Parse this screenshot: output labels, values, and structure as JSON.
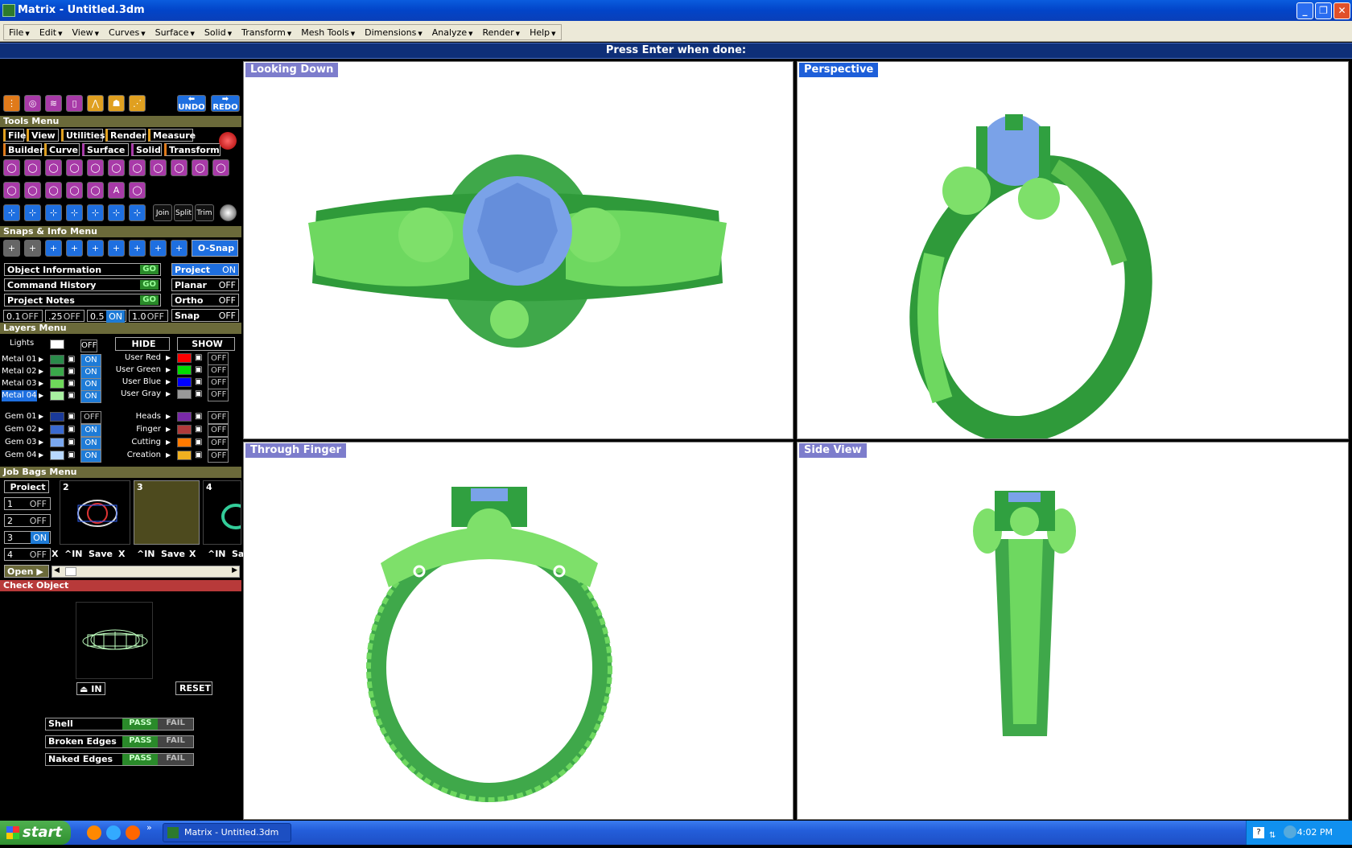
{
  "window": {
    "title": "Matrix -  Untitled.3dm"
  },
  "menubar": [
    "File",
    "Edit",
    "View",
    "Curves",
    "Surface",
    "Solid",
    "Transform",
    "Mesh Tools",
    "Dimensions",
    "Analyze",
    "Render",
    "Help"
  ],
  "prompt": "Press Enter when done:",
  "toolbar": {
    "undo": "UNDO",
    "redo": "REDO"
  },
  "tools_menu": {
    "header": "Tools Menu",
    "row1": [
      "File",
      "View",
      "Utilities",
      "Render",
      "Measure"
    ],
    "row2": [
      "Builder",
      "Curve",
      "Surface",
      "Solid",
      "Transform"
    ],
    "join": "Join",
    "split": "Split",
    "trim": "Trim",
    "text_tool": "A"
  },
  "snaps": {
    "header": "Snaps & Info Menu",
    "osnap": "O-Snap",
    "info": [
      {
        "label": "Object Information",
        "go": "GO"
      },
      {
        "label": "Command History",
        "go": "GO"
      },
      {
        "label": "Project Notes",
        "go": "GO"
      }
    ],
    "toggles": [
      {
        "label": "Project",
        "state": "ON"
      },
      {
        "label": "Planar",
        "state": "OFF"
      },
      {
        "label": "Ortho",
        "state": "OFF"
      },
      {
        "label": "Snap",
        "state": "OFF"
      }
    ],
    "grid": [
      {
        "label": "0.1",
        "state": "OFF"
      },
      {
        "label": ".25",
        "state": "OFF"
      },
      {
        "label": "0.5",
        "state": "ON"
      },
      {
        "label": "1.0",
        "state": "OFF"
      }
    ]
  },
  "layers": {
    "header": "Layers  Menu",
    "lights_label": "Lights",
    "lights_state": "OFF",
    "hide": "HIDE",
    "show": "SHOW",
    "metals": [
      {
        "name": "Metal 01",
        "color": "#2a8a4a",
        "state": "ON"
      },
      {
        "name": "Metal 02",
        "color": "#3aa84a",
        "state": "ON"
      },
      {
        "name": "Metal 03",
        "color": "#6ed85a",
        "state": "ON"
      },
      {
        "name": "Metal 04",
        "color": "#a8f0a0",
        "state": "ON"
      }
    ],
    "user": [
      {
        "name": "User Red",
        "color": "#ff0000",
        "state": "OFF"
      },
      {
        "name": "User Green",
        "color": "#00dd00",
        "state": "OFF"
      },
      {
        "name": "User Blue",
        "color": "#0000ff",
        "state": "OFF"
      },
      {
        "name": "User Gray",
        "color": "#999999",
        "state": "OFF"
      }
    ],
    "gems": [
      {
        "name": "Gem 01",
        "color": "#1a3a9a",
        "state": "OFF"
      },
      {
        "name": "Gem 02",
        "color": "#3a6ad0",
        "state": "ON"
      },
      {
        "name": "Gem 03",
        "color": "#7aa8f0",
        "state": "ON"
      },
      {
        "name": "Gem 04",
        "color": "#b8d8ff",
        "state": "ON"
      }
    ],
    "other": [
      {
        "name": "Heads",
        "color": "#7a2aa8",
        "state": "OFF"
      },
      {
        "name": "Finger",
        "color": "#b03a3a",
        "state": "OFF"
      },
      {
        "name": "Cutting",
        "color": "#ff7a00",
        "state": "OFF"
      },
      {
        "name": "Creation",
        "color": "#f0b020",
        "state": "OFF"
      }
    ]
  },
  "jobbags": {
    "header": "Job Bags Menu",
    "project": "Proiect",
    "slots": [
      {
        "n": "1",
        "state": "OFF"
      },
      {
        "n": "2",
        "state": "OFF"
      },
      {
        "n": "3",
        "state": "ON"
      },
      {
        "n": "4",
        "state": "OFF"
      }
    ],
    "thumbs": [
      "2",
      "3",
      "4"
    ],
    "x": "X",
    "in": "^IN",
    "save": "Save",
    "sa": "Sa",
    "open": "Open"
  },
  "check": {
    "header": "Check Object",
    "in": "IN",
    "reset": "RESET",
    "rows": [
      {
        "label": "Shell",
        "pass": "PASS",
        "fail": "FAIL"
      },
      {
        "label": "Broken Edges",
        "pass": "PASS",
        "fail": "FAIL"
      },
      {
        "label": "Naked Edges",
        "pass": "PASS",
        "fail": "FAIL"
      }
    ]
  },
  "viewports": {
    "top": "Looking Down",
    "persp": "Perspective",
    "front": "Through Finger",
    "side": "Side View"
  },
  "taskbar": {
    "start": "start",
    "app": "Matrix -  Untitled.3dm",
    "clock": "4:02 PM"
  }
}
